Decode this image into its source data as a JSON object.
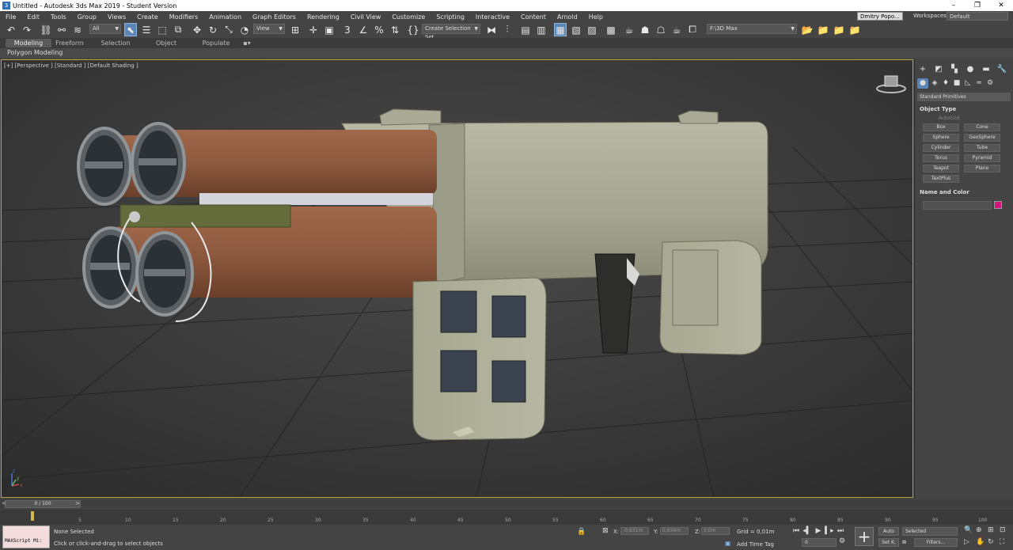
{
  "window": {
    "title": "Untitled - Autodesk 3ds Max 2019 - Student Version",
    "icon": "3"
  },
  "window_controls": [
    "–",
    "❐",
    "✕"
  ],
  "menu": [
    "File",
    "Edit",
    "Tools",
    "Group",
    "Views",
    "Create",
    "Modifiers",
    "Animation",
    "Graph Editors",
    "Rendering",
    "Civil View",
    "Customize",
    "Scripting",
    "Interactive",
    "Content",
    "Arnold",
    "Help"
  ],
  "user": {
    "name": "Dmitry Popo...",
    "workspaces_label": "Workspaces:",
    "workspace": "Default"
  },
  "toolbar": {
    "filter": "All",
    "ref_coord": "View",
    "selection_set": "Create Selection Set",
    "project_path": "F:\\3D Max"
  },
  "ribbon": {
    "tabs": [
      "Modeling",
      "Freeform",
      "Selection",
      "Object Paint",
      "Populate"
    ],
    "active_tab": "Modeling",
    "panel": "Polygon Modeling"
  },
  "viewport": {
    "label": "[+] [Perspective ] [Standard ] [Default Shading ]",
    "axis_labels": {
      "x": "x",
      "y": "y",
      "z": "z"
    }
  },
  "command_panel": {
    "category": "Standard Primitives",
    "object_type_title": "Object Type",
    "autogrid": "AutoGrid",
    "primitives": [
      "Box",
      "Cone",
      "Sphere",
      "GeoSphere",
      "Cylinder",
      "Tube",
      "Torus",
      "Pyramid",
      "Teapot",
      "Plane",
      "TextPlus"
    ],
    "name_color_title": "Name and Color",
    "object_color": "#d0157f"
  },
  "timeline": {
    "frame_display": "0 / 100",
    "ticks": [
      "5",
      "10",
      "15",
      "20",
      "25",
      "30",
      "35",
      "40",
      "45",
      "50",
      "55",
      "60",
      "65",
      "70",
      "75",
      "80",
      "85",
      "90",
      "95",
      "100"
    ]
  },
  "status": {
    "maxscript": "MAXScript Mi:",
    "selection": "None Selected",
    "prompt": "Click or click-and-drag to select objects",
    "x_label": "X:",
    "x_value": "-0,631m",
    "y_label": "Y:",
    "y_value": "0,634m",
    "z_label": "Z:",
    "z_value": "0,0m",
    "grid": "Grid = 0,01m",
    "add_time_tag": "Add Time Tag",
    "auto": "Auto",
    "key_mode": "Selected",
    "set_key": "Set K.",
    "filters": "Filters...",
    "frame": "0"
  }
}
